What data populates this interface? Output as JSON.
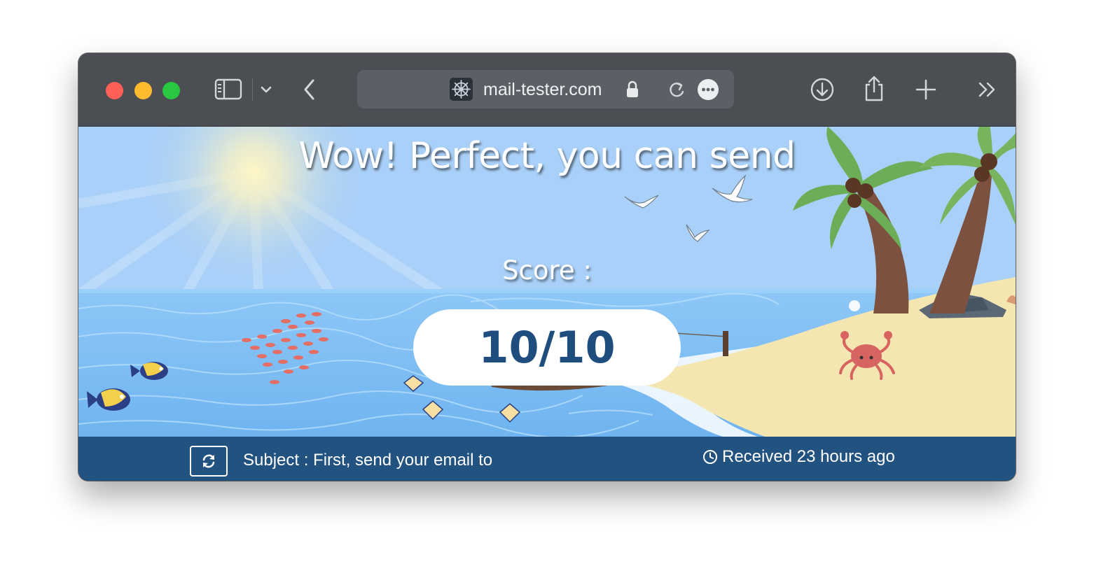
{
  "browser": {
    "address_bar": {
      "url": "mail-tester.com"
    },
    "toolbar_icons": [
      "sidebar-icon",
      "chevron-down-icon",
      "back-icon",
      "lock-icon",
      "reload-icon",
      "more-icon",
      "download-icon",
      "share-icon",
      "new-tab-icon",
      "overflow-icon"
    ]
  },
  "page": {
    "headline": "Wow! Perfect, you can send",
    "score_label": "Score :",
    "score_value": "10/10",
    "footer": {
      "refresh_icon": "refresh-icon",
      "subject": "Subject : First, send your email to",
      "received": "Received 23 hours ago",
      "received_icon": "clock-icon"
    }
  },
  "colors": {
    "toolbar": "#4b4e53",
    "address_bar": "#5c6066",
    "sky": "#a9d0f8",
    "sea": "#7fbdf6",
    "sand": "#f3e6b0",
    "footer": "#22527f",
    "score_text": "#1e4d7e",
    "traffic_red": "#fe5f57",
    "traffic_yellow": "#febc2e",
    "traffic_green": "#28c840"
  }
}
